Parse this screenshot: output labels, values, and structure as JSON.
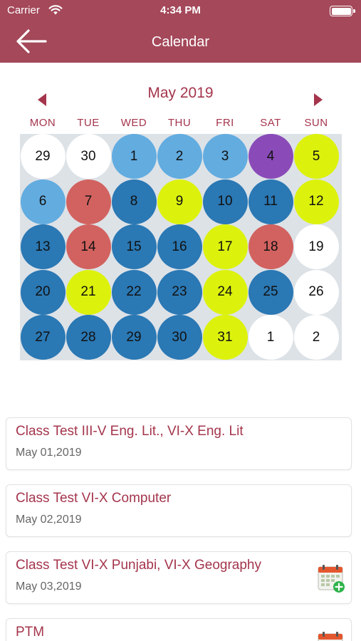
{
  "status_bar": {
    "carrier": "Carrier",
    "time": "4:34 PM"
  },
  "header": {
    "title": "Calendar",
    "background_color": "#a4485a"
  },
  "calendar": {
    "month_title": "May 2019",
    "weekdays": [
      "MON",
      "TUE",
      "WED",
      "THU",
      "FRI",
      "SAT",
      "SUN"
    ],
    "legend_colors": {
      "white": "#ffffff",
      "light_blue": "#62ace0",
      "dark_blue": "#2a78b4",
      "yellow": "#dcf20c",
      "red": "#d2625f",
      "purple": "#8a4bb8"
    },
    "days": [
      {
        "label": "29",
        "color": "white"
      },
      {
        "label": "30",
        "color": "white"
      },
      {
        "label": "1",
        "color": "light_blue"
      },
      {
        "label": "2",
        "color": "light_blue"
      },
      {
        "label": "3",
        "color": "light_blue"
      },
      {
        "label": "4",
        "color": "purple"
      },
      {
        "label": "5",
        "color": "yellow"
      },
      {
        "label": "6",
        "color": "light_blue"
      },
      {
        "label": "7",
        "color": "red"
      },
      {
        "label": "8",
        "color": "dark_blue"
      },
      {
        "label": "9",
        "color": "yellow"
      },
      {
        "label": "10",
        "color": "dark_blue"
      },
      {
        "label": "11",
        "color": "dark_blue"
      },
      {
        "label": "12",
        "color": "yellow"
      },
      {
        "label": "13",
        "color": "dark_blue"
      },
      {
        "label": "14",
        "color": "red"
      },
      {
        "label": "15",
        "color": "dark_blue"
      },
      {
        "label": "16",
        "color": "dark_blue"
      },
      {
        "label": "17",
        "color": "yellow"
      },
      {
        "label": "18",
        "color": "red"
      },
      {
        "label": "19",
        "color": "white"
      },
      {
        "label": "20",
        "color": "dark_blue"
      },
      {
        "label": "21",
        "color": "yellow"
      },
      {
        "label": "22",
        "color": "dark_blue"
      },
      {
        "label": "23",
        "color": "dark_blue"
      },
      {
        "label": "24",
        "color": "yellow"
      },
      {
        "label": "25",
        "color": "dark_blue"
      },
      {
        "label": "26",
        "color": "white"
      },
      {
        "label": "27",
        "color": "dark_blue"
      },
      {
        "label": "28",
        "color": "dark_blue"
      },
      {
        "label": "29",
        "color": "dark_blue"
      },
      {
        "label": "30",
        "color": "dark_blue"
      },
      {
        "label": "31",
        "color": "yellow"
      },
      {
        "label": "1",
        "color": "white"
      },
      {
        "label": "2",
        "color": "white"
      }
    ]
  },
  "events": [
    {
      "title": "Class Test III-V Eng. Lit., VI-X Eng. Lit",
      "date": "May 01,2019",
      "has_calendar_icon": false
    },
    {
      "title": "Class Test VI-X Computer",
      "date": "May 02,2019",
      "has_calendar_icon": false
    },
    {
      "title": "Class Test VI-X Punjabi, VI-X Geography",
      "date": "May 03,2019",
      "has_calendar_icon": true
    },
    {
      "title": "PTM",
      "date": "",
      "has_calendar_icon": true
    }
  ],
  "icons": {
    "back": "back-arrow-icon",
    "prev": "prev-month-icon",
    "next": "next-month-icon",
    "add_to_calendar": "calendar-add-icon",
    "wifi": "wifi-icon",
    "battery": "battery-icon"
  }
}
